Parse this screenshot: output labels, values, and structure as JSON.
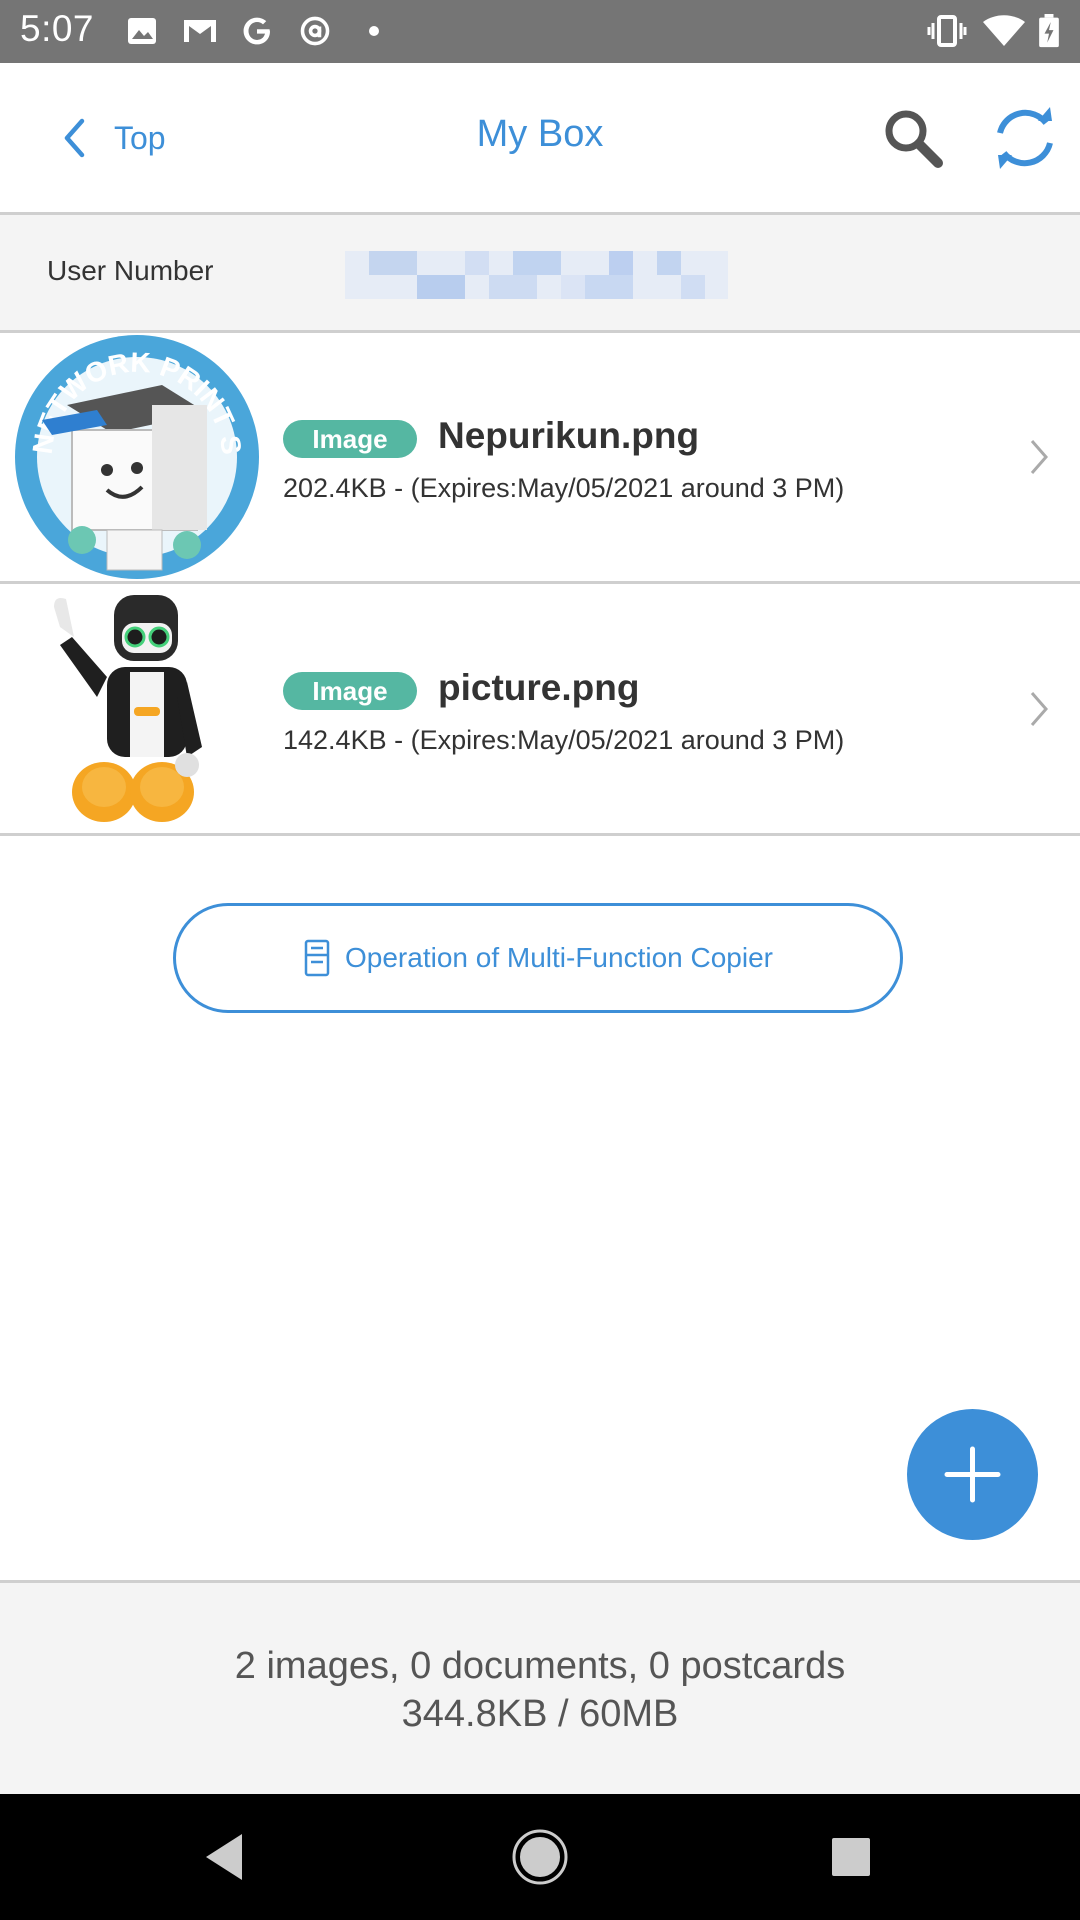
{
  "status_bar": {
    "time": "5:07",
    "icons": [
      "image-icon",
      "gmail-icon",
      "google-icon",
      "at-sign-icon",
      "dot-icon",
      "vibrate-icon",
      "wifi-icon",
      "battery-icon"
    ]
  },
  "header": {
    "back_label": "Top",
    "title": "My Box",
    "search_icon": "search-icon",
    "refresh_icon": "refresh-icon"
  },
  "user": {
    "label": "User Number"
  },
  "files": [
    {
      "badge": "Image",
      "name": "Nepurikun.png",
      "meta": "202.4KB - (Expires:May/05/2021 around 3 PM)",
      "logo_text": "NETWORK PRINT SERVICE"
    },
    {
      "badge": "Image",
      "name": "picture.png",
      "meta": "142.4KB - (Expires:May/05/2021 around 3 PM)"
    }
  ],
  "copier_button": {
    "label": "Operation of Multi-Function Copier",
    "icon": "copier-icon"
  },
  "fab": {
    "icon": "plus-icon"
  },
  "summary": {
    "counts": "2 images, 0 documents, 0 postcards",
    "usage": "344.8KB / 60MB"
  },
  "colors": {
    "accent": "#3d8fd8",
    "badge": "#55b7a2",
    "status_bar": "#757575",
    "divider": "#cfcfcf",
    "panel": "#f4f4f4"
  }
}
